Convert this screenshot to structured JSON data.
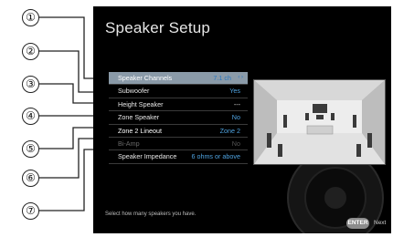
{
  "callouts": [
    "①",
    "②",
    "③",
    "④",
    "⑤",
    "⑥",
    "⑦"
  ],
  "screen": {
    "title": "Speaker Setup",
    "menu": [
      {
        "label": "Speaker Channels",
        "value": "7.1 ch",
        "arrows": "‹ ›"
      },
      {
        "label": "Subwoofer",
        "value": "Yes"
      },
      {
        "label": "Height Speaker",
        "value": "---"
      },
      {
        "label": "Zone Speaker",
        "value": "No"
      },
      {
        "label": "Zone 2 Lineout",
        "value": "Zone 2"
      },
      {
        "label": "Bi-Amp",
        "value": "No"
      },
      {
        "label": "Speaker Impedance",
        "value": "6 ohms or above"
      }
    ],
    "hint": "Select how many speakers you have.",
    "footer": {
      "enter_label": "ENTER",
      "next_label": "Next"
    }
  },
  "colors": {
    "accent": "#4fa3e0",
    "highlight": "#8a9aa8",
    "screen_bg": "#000000"
  }
}
